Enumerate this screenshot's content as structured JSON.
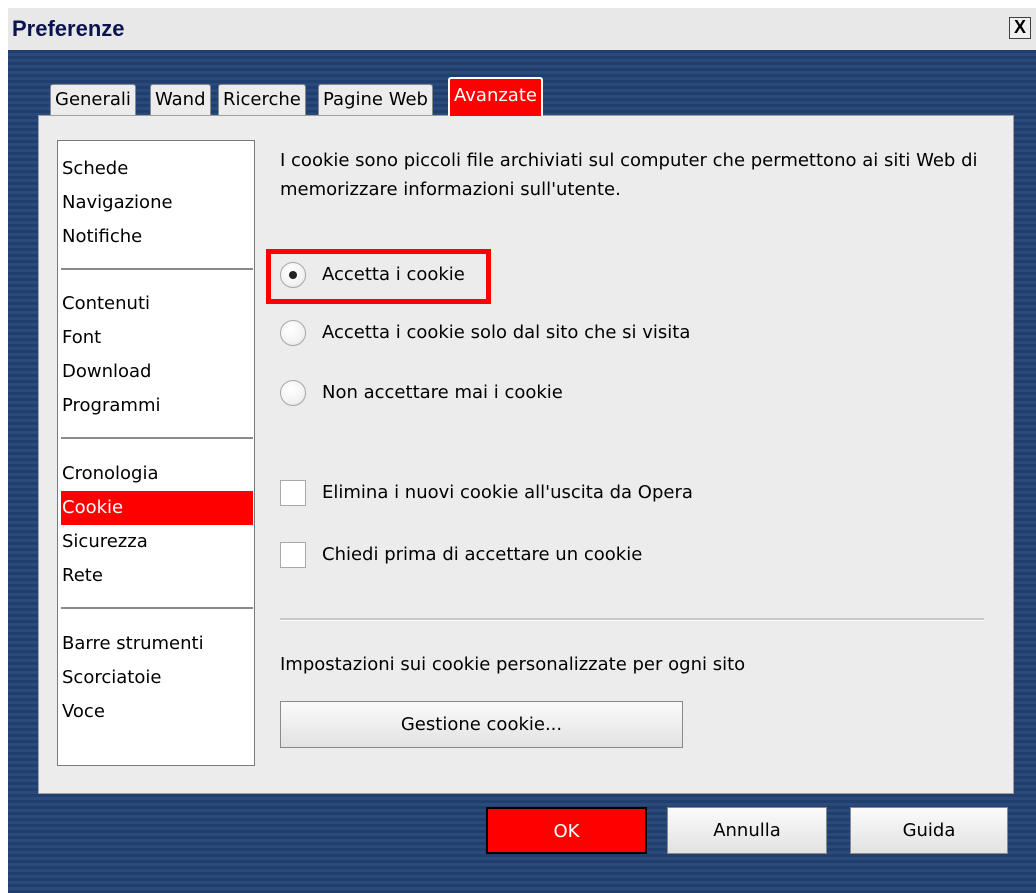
{
  "window": {
    "title": "Preferenze",
    "close_label": "X"
  },
  "tabs": [
    {
      "label": "Generali",
      "active": false
    },
    {
      "label": "Wand",
      "active": false
    },
    {
      "label": "Ricerche",
      "active": false
    },
    {
      "label": "Pagine Web",
      "active": false
    },
    {
      "label": "Avanzate",
      "active": true
    }
  ],
  "sidebar": {
    "groups": [
      [
        "Schede",
        "Navigazione",
        "Notifiche"
      ],
      [
        "Contenuti",
        "Font",
        "Download",
        "Programmi"
      ],
      [
        "Cronologia",
        "Cookie",
        "Sicurezza",
        "Rete"
      ],
      [
        "Barre strumenti",
        "Scorciatoie",
        "Voce"
      ]
    ],
    "selected": "Cookie"
  },
  "content": {
    "description": "I cookie sono piccoli file archiviati sul computer che permettono ai siti Web di memorizzare informazioni sull'utente.",
    "radios": [
      {
        "label": "Accetta i cookie",
        "checked": true
      },
      {
        "label": "Accetta i cookie solo dal sito che si visita",
        "checked": false
      },
      {
        "label": "Non accettare mai i cookie",
        "checked": false
      }
    ],
    "checkboxes": [
      {
        "label": "Elimina i nuovi cookie all'uscita da Opera",
        "checked": false
      },
      {
        "label": "Chiedi prima di accettare un cookie",
        "checked": false
      }
    ],
    "site_settings_label": "Impostazioni sui cookie personalizzate per ogni sito",
    "manage_button": "Gestione cookie..."
  },
  "buttons": {
    "ok": "OK",
    "cancel": "Annulla",
    "help": "Guida"
  },
  "colors": {
    "accent": "#ff0000",
    "background": "#203e6e",
    "panel": "#ececec"
  }
}
